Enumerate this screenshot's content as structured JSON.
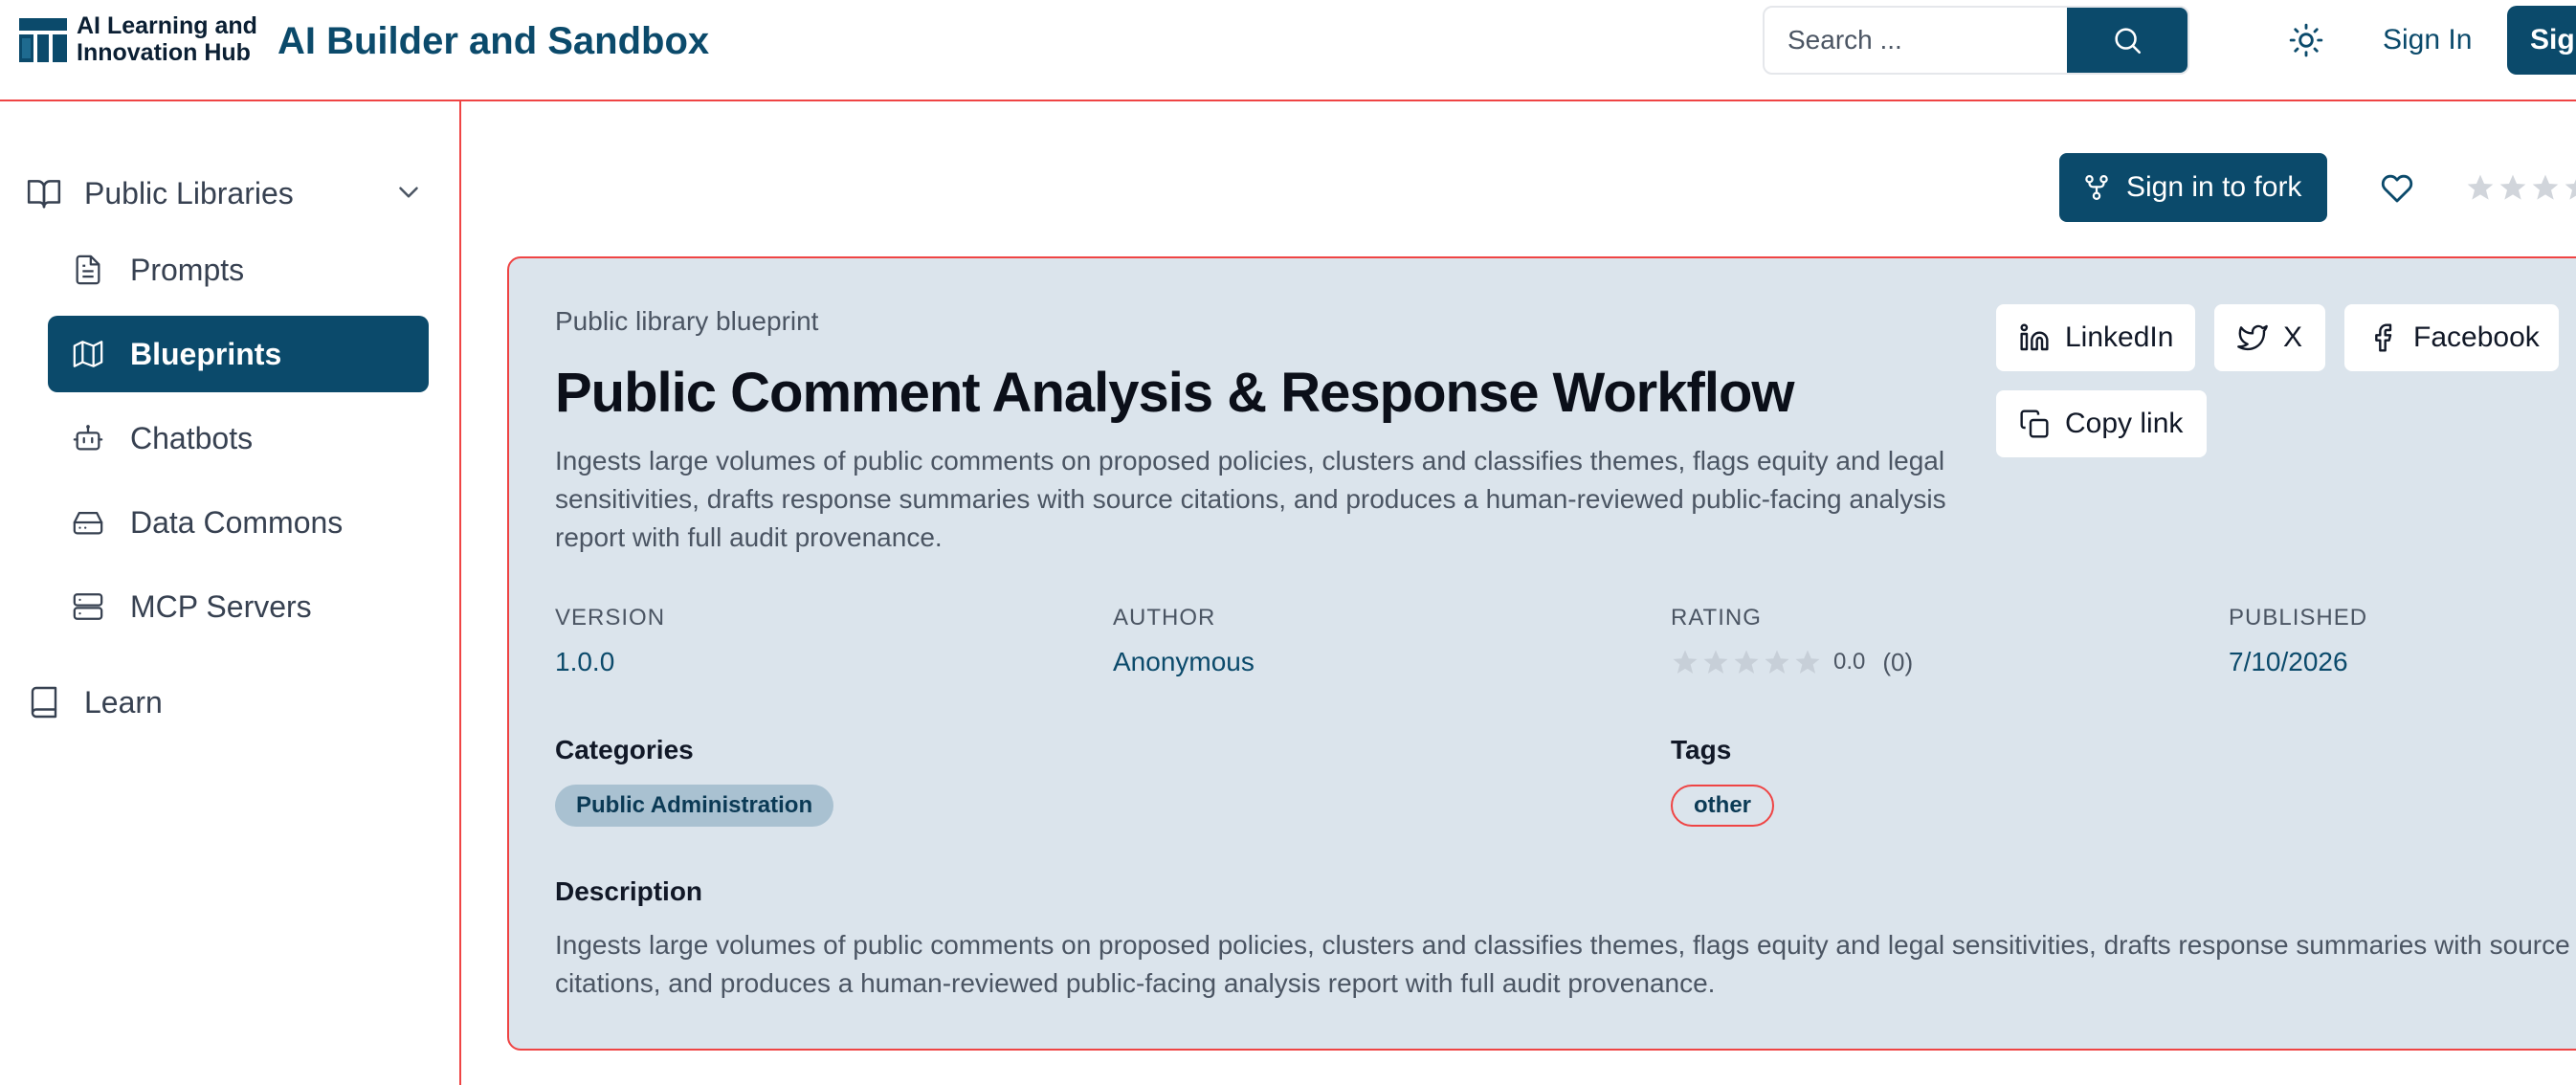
{
  "brand": {
    "logo_text_line1": "AI Learning and",
    "logo_text_line2": "Innovation Hub",
    "app_title": "AI Builder and Sandbox"
  },
  "header": {
    "search_placeholder": "Search ...",
    "sign_in": "Sign In",
    "sign_up": "Sign Up"
  },
  "sidebar": {
    "group_label": "Public Libraries",
    "items": [
      {
        "label": "Prompts",
        "icon": "document-icon",
        "active": false
      },
      {
        "label": "Blueprints",
        "icon": "map-icon",
        "active": true
      },
      {
        "label": "Chatbots",
        "icon": "robot-icon",
        "active": false
      },
      {
        "label": "Data Commons",
        "icon": "drive-icon",
        "active": false
      },
      {
        "label": "MCP Servers",
        "icon": "server-icon",
        "active": false
      }
    ],
    "learn_label": "Learn"
  },
  "actions": {
    "fork_label": "Sign in to fork",
    "share": {
      "linkedin": "LinkedIn",
      "x": "X",
      "facebook": "Facebook",
      "copy_link": "Copy link"
    }
  },
  "blueprint": {
    "kicker": "Public library blueprint",
    "title": "Public Comment Analysis & Response Workflow",
    "summary": "Ingests large volumes of public comments on proposed policies, clusters and classifies themes, flags equity and legal sensitivities, drafts response summaries with source citations, and produces a human-reviewed public-facing analysis report with full audit provenance.",
    "meta": {
      "version_label": "VERSION",
      "version": "1.0.0",
      "author_label": "AUTHOR",
      "author": "Anonymous",
      "rating_label": "RATING",
      "rating": "0.0",
      "rating_count": "(0)",
      "published_label": "PUBLISHED",
      "published": "7/10/2026"
    },
    "categories_label": "Categories",
    "category": "Public Administration",
    "tags_label": "Tags",
    "tag": "other",
    "description_label": "Description",
    "description": "Ingests large volumes of public comments on proposed policies, clusters and classifies themes, flags equity and legal sensitivities, drafts response summaries with source citations, and produces a human-reviewed public-facing analysis report with full audit provenance."
  },
  "colors": {
    "accent": "#0b4a6b",
    "card_bg": "#dbe4ec",
    "highlight_border": "#ef4444"
  }
}
